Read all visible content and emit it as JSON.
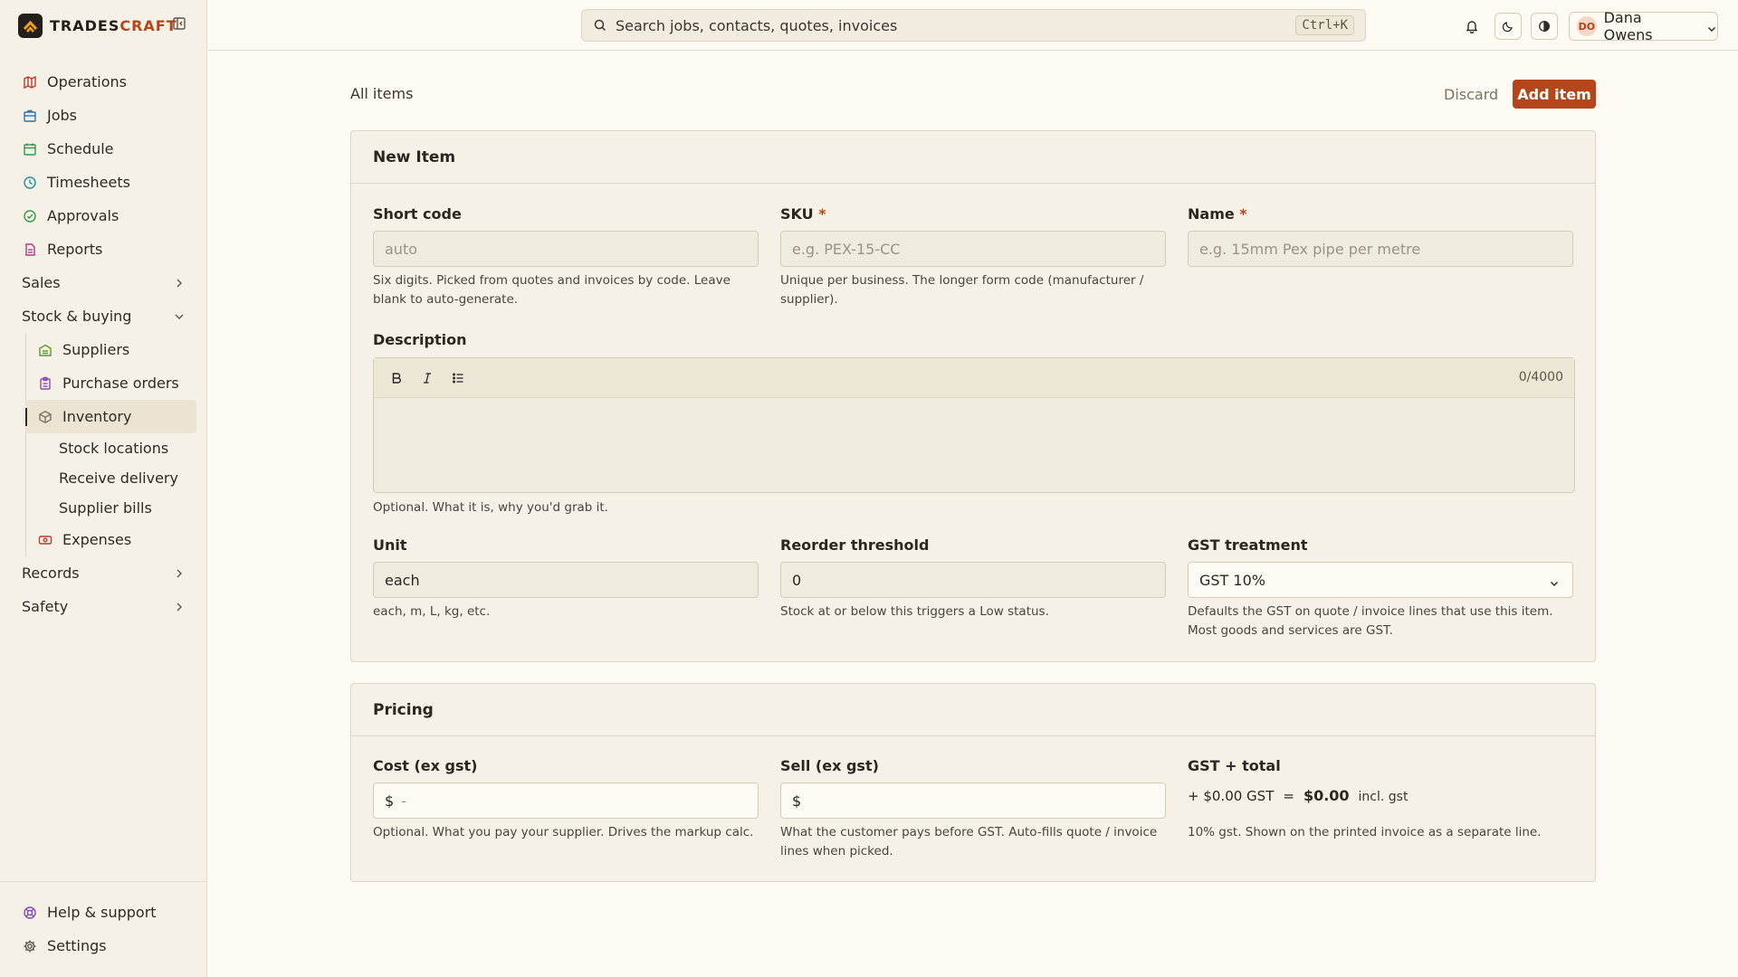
{
  "brand": {
    "name_main": "TRADES",
    "name_accent": "CRAFT"
  },
  "sidebar": {
    "items": [
      {
        "label": "Operations",
        "icon": "map-icon",
        "color": "#c0392b"
      },
      {
        "label": "Jobs",
        "icon": "briefcase-icon",
        "color": "#2f6fb5"
      },
      {
        "label": "Schedule",
        "icon": "calendar-icon",
        "color": "#2f9a4a"
      },
      {
        "label": "Timesheets",
        "icon": "clock-icon",
        "color": "#1f8fa3"
      },
      {
        "label": "Approvals",
        "icon": "check-circle-icon",
        "color": "#2f9a4a"
      },
      {
        "label": "Reports",
        "icon": "document-icon",
        "color": "#b03a8a"
      }
    ],
    "sales": "Sales",
    "stock": "Stock & buying",
    "stock_items": [
      {
        "label": "Suppliers",
        "icon": "warehouse-icon",
        "color": "#5a9a2a"
      },
      {
        "label": "Purchase orders",
        "icon": "clipboard-icon",
        "color": "#8a4ab5"
      },
      {
        "label": "Inventory",
        "icon": "box-icon",
        "color": "#7a7366"
      }
    ],
    "inventory_children": [
      "Stock locations",
      "Receive delivery",
      "Supplier bills"
    ],
    "expenses": {
      "label": "Expenses",
      "icon": "receipt-icon",
      "color": "#c0392b"
    },
    "records": "Records",
    "safety": "Safety",
    "help": "Help & support",
    "settings": "Settings"
  },
  "topbar": {
    "search_placeholder": "Search jobs, contacts, quotes, invoices",
    "shortcut": "Ctrl+K",
    "user_initials": "DO",
    "user_name": "Dana Owens"
  },
  "page": {
    "breadcrumb": "All items",
    "discard": "Discard",
    "add": "Add item"
  },
  "new_item": {
    "title": "New Item",
    "short_code": {
      "label": "Short code",
      "placeholder": "auto",
      "help": "Six digits. Picked from quotes and invoices by code. Leave blank to auto-generate."
    },
    "sku": {
      "label": "SKU",
      "required": "*",
      "placeholder": "e.g. PEX-15-CC",
      "help": "Unique per business. The longer form code (manufacturer / supplier)."
    },
    "name": {
      "label": "Name",
      "required": "*",
      "placeholder": "e.g. 15mm Pex pipe per metre"
    },
    "description": {
      "label": "Description",
      "counter": "0/4000",
      "help": "Optional. What it is, why you'd grab it."
    },
    "unit": {
      "label": "Unit",
      "value": "each",
      "help": "each, m, L, kg, etc."
    },
    "reorder": {
      "label": "Reorder threshold",
      "value": "0",
      "help": "Stock at or below this triggers a Low status."
    },
    "gst": {
      "label": "GST treatment",
      "value": "GST 10%",
      "help": "Defaults the GST on quote / invoice lines that use this item. Most goods and services are GST."
    }
  },
  "pricing": {
    "title": "Pricing",
    "cost": {
      "label": "Cost (ex gst)",
      "currency": "$",
      "placeholder": "-",
      "help": "Optional. What you pay your supplier. Drives the markup calc."
    },
    "sell": {
      "label": "Sell (ex gst)",
      "currency": "$",
      "help": "What the customer pays before GST. Auto-fills quote / invoice lines when picked."
    },
    "gst_total": {
      "label": "GST + total",
      "gst_part": "+ $0.00 GST",
      "equals": "=",
      "total": "$0.00",
      "suffix": "incl. gst",
      "help": "10% gst. Shown on the printed invoice as a separate line."
    }
  }
}
